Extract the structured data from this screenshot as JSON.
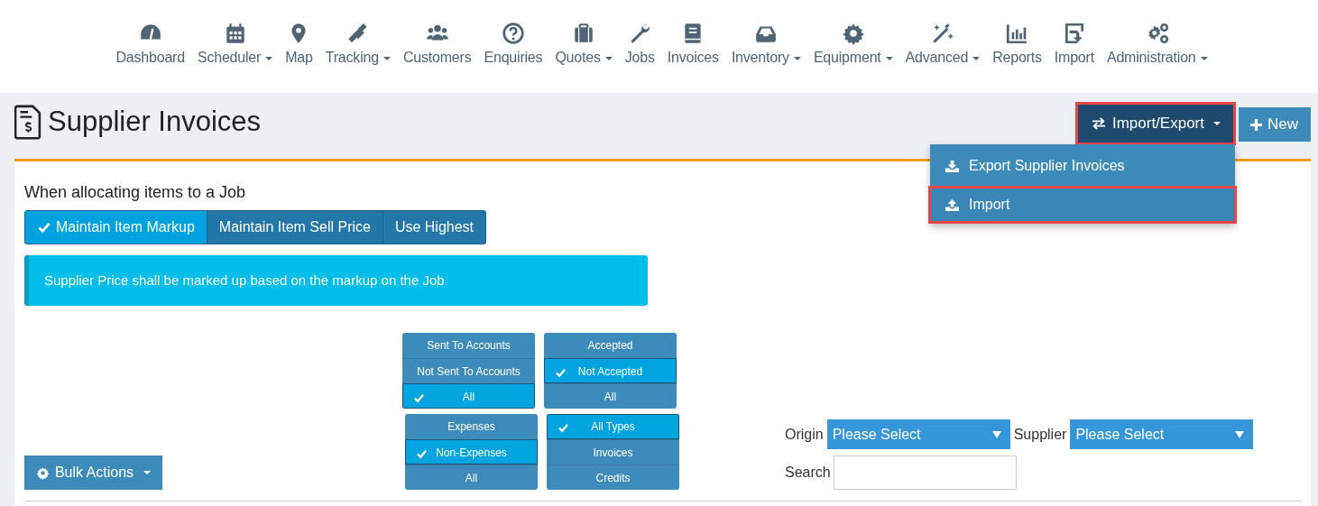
{
  "nav": [
    {
      "label": "Dashboard",
      "dropdown": false
    },
    {
      "label": "Scheduler",
      "dropdown": true
    },
    {
      "label": "Map",
      "dropdown": false
    },
    {
      "label": "Tracking",
      "dropdown": true
    },
    {
      "label": "Customers",
      "dropdown": false
    },
    {
      "label": "Enquiries",
      "dropdown": false
    },
    {
      "label": "Quotes",
      "dropdown": true
    },
    {
      "label": "Jobs",
      "dropdown": false
    },
    {
      "label": "Invoices",
      "dropdown": false
    },
    {
      "label": "Inventory",
      "dropdown": true
    },
    {
      "label": "Equipment",
      "dropdown": true
    },
    {
      "label": "Advanced",
      "dropdown": true
    },
    {
      "label": "Reports",
      "dropdown": false
    },
    {
      "label": "Import",
      "dropdown": false
    },
    {
      "label": "Administration",
      "dropdown": true
    }
  ],
  "page": {
    "title": "Supplier Invoices"
  },
  "header_buttons": {
    "import_export": {
      "label": "Import/Export",
      "expanded": true,
      "highlighted": true
    },
    "new": {
      "label": "New"
    }
  },
  "dropdown_menu": [
    {
      "label": "Export Supplier Invoices",
      "highlighted": false
    },
    {
      "label": "Import",
      "highlighted": true
    }
  ],
  "allocation": {
    "heading": "When allocating items to a Job",
    "options": [
      {
        "label": "Maintain Item Markup",
        "selected": true
      },
      {
        "label": "Maintain Item Sell Price",
        "selected": false
      },
      {
        "label": "Use Highest",
        "selected": false
      }
    ],
    "info": "Supplier Price shall be marked up based on the markup on the Job"
  },
  "filter_groups": [
    {
      "options": [
        {
          "label": "Sent To Accounts",
          "selected": false
        },
        {
          "label": "Not Sent To Accounts",
          "selected": false
        },
        {
          "label": "All",
          "selected": true
        }
      ]
    },
    {
      "options": [
        {
          "label": "Accepted",
          "selected": false
        },
        {
          "label": "Not Accepted",
          "selected": true
        },
        {
          "label": "All",
          "selected": false
        }
      ]
    },
    {
      "options": [
        {
          "label": "Expenses",
          "selected": false
        },
        {
          "label": "Non-Expenses",
          "selected": true
        },
        {
          "label": "All",
          "selected": false
        }
      ]
    },
    {
      "options": [
        {
          "label": "All Types",
          "selected": true
        },
        {
          "label": "Invoices",
          "selected": false
        },
        {
          "label": "Credits",
          "selected": false
        }
      ]
    }
  ],
  "bulk_actions": {
    "label": "Bulk Actions"
  },
  "origin": {
    "label": "Origin",
    "value": "Please Select"
  },
  "supplier": {
    "label": "Supplier",
    "value": "Please Select"
  },
  "search": {
    "label": "Search"
  }
}
